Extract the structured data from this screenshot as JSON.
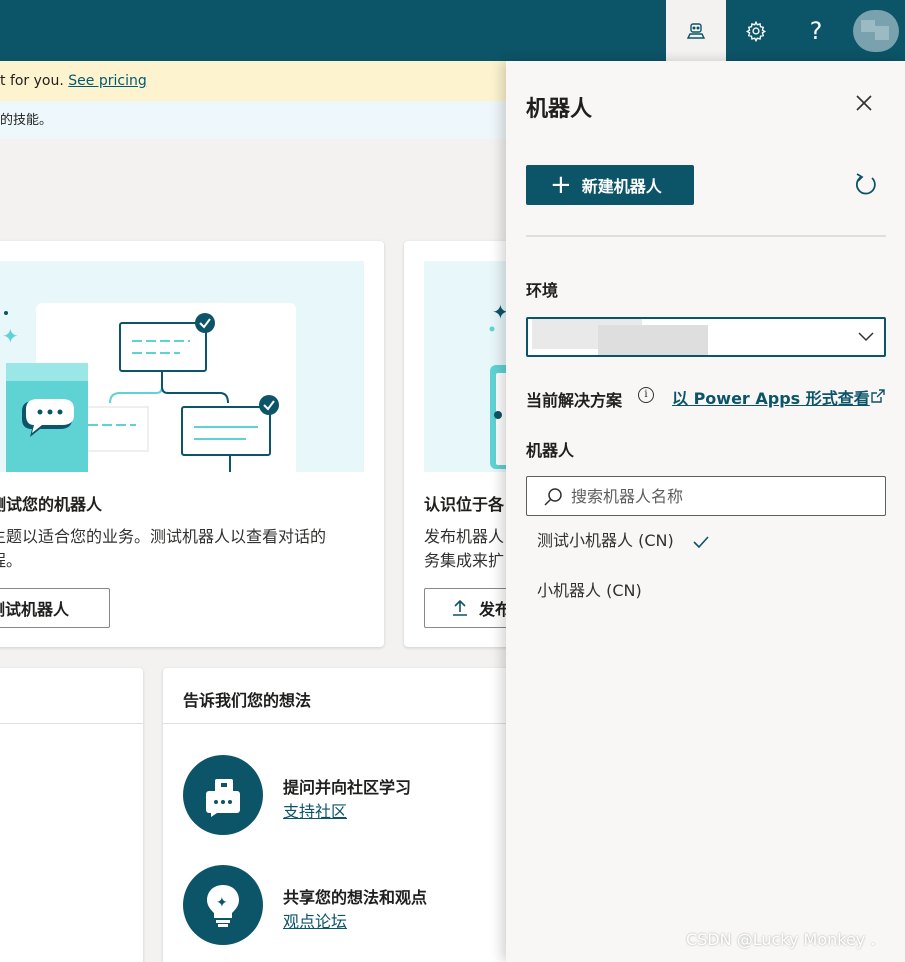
{
  "header": {
    "bot_icon": "bot-icon",
    "settings_icon": "gear-icon",
    "help_label": "?",
    "avatar": "avatar"
  },
  "banners": {
    "trial_text": "t for you.",
    "trial_link": "See pricing",
    "info_text": "的技能。"
  },
  "cards": [
    {
      "title": "测试您的机器人",
      "desc_line1": "主题以适合您的业务。测试机器人以查看对话的",
      "desc_line2": "程。",
      "button": "测试机器人"
    },
    {
      "title": "认识位于各",
      "desc_line1": "发布机器人",
      "desc_line2": "务集成来扩",
      "button": "发布"
    }
  ],
  "feedback": {
    "title": "告诉我们您的想法",
    "items": [
      {
        "title": "提问并向社区学习",
        "link": "支持社区",
        "icon": "chat-bubbles-icon"
      },
      {
        "title": "共享您的想法和观点",
        "link": "观点论坛",
        "icon": "lightbulb-icon"
      }
    ]
  },
  "panel": {
    "title": "机器人",
    "new_bot_label": "新建机器人",
    "environment_label": "环境",
    "environment_value": "",
    "solution_label": "当前解决方案",
    "power_apps_link": "以 Power Apps 形式查看",
    "bots_label": "机器人",
    "search_placeholder": "搜索机器人名称",
    "bots": [
      {
        "name": "测试小机器人 (CN)",
        "selected": true
      },
      {
        "name": "小机器人 (CN)",
        "selected": false
      }
    ]
  },
  "watermark": "CSDN @Lucky Monkey .",
  "colors": {
    "brand": "#0c5468",
    "banner_yellow": "#fdf4cf",
    "banner_blue": "#eef7fb",
    "illustration_bg": "#e8f7fa",
    "accent_teal": "#5fd3d3"
  }
}
